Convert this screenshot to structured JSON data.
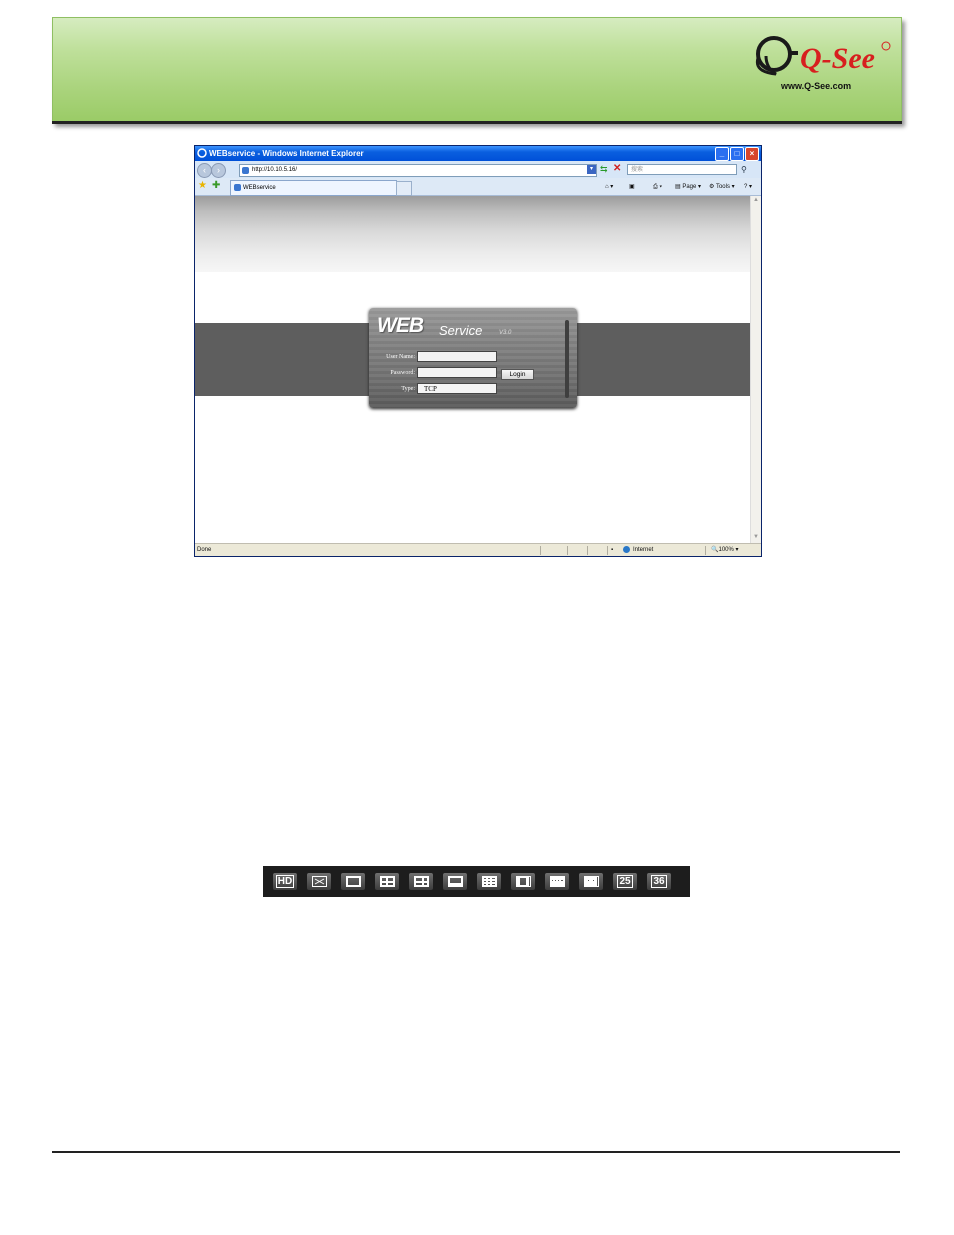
{
  "logo": {
    "brand": "Q-See",
    "url": "www.Q-See.com"
  },
  "browser": {
    "title": "WEBservice - Windows Internet Explorer",
    "address": "http://10.10.5.16/",
    "search_placeholder": "搜索",
    "tab_title": "WEBservice",
    "commands": {
      "page": "Page",
      "tools": "Tools"
    },
    "status": {
      "left": "Done",
      "zone": "Internet",
      "zoom": "100%"
    }
  },
  "login": {
    "logo_web": "WEB",
    "logo_service": "Service",
    "version": "V3.0",
    "username_label": "User Name:",
    "password_label": "Password:",
    "type_label": "Type:",
    "type_value": "TCP",
    "login_button": "Login"
  },
  "toolbar": {
    "items": [
      {
        "name": "hd-icon",
        "label": "HD"
      },
      {
        "name": "fullscreen-icon"
      },
      {
        "name": "layout-1-icon"
      },
      {
        "name": "layout-4-icon"
      },
      {
        "name": "layout-6-icon"
      },
      {
        "name": "layout-8-icon"
      },
      {
        "name": "layout-9-icon"
      },
      {
        "name": "layout-13-icon"
      },
      {
        "name": "layout-16-icon"
      },
      {
        "name": "layout-20-icon"
      },
      {
        "name": "layout-25-icon",
        "label": "25"
      },
      {
        "name": "layout-36-icon",
        "label": "36"
      }
    ]
  }
}
